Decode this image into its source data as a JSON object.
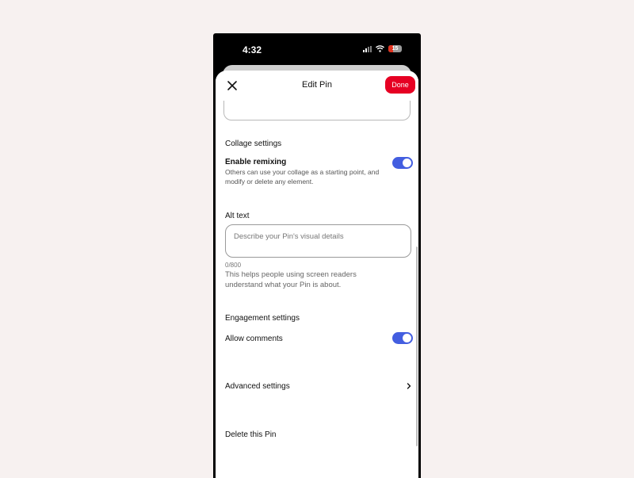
{
  "status_bar": {
    "time": "4:32",
    "battery": "15"
  },
  "header": {
    "title": "Edit Pin",
    "done_label": "Done"
  },
  "collage": {
    "section_label": "Collage settings",
    "remix_title": "Enable remixing",
    "remix_desc": "Others can use your collage as a starting point, and modify or delete any element.",
    "remix_enabled": true
  },
  "alt_text": {
    "section_label": "Alt text",
    "placeholder": "Describe your Pin's visual details",
    "counter": "0/800",
    "helper": "This helps people using screen readers understand what your Pin is about."
  },
  "engagement": {
    "section_label": "Engagement settings",
    "comments_title": "Allow comments",
    "comments_enabled": true
  },
  "advanced": {
    "label": "Advanced settings"
  },
  "delete": {
    "label": "Delete this Pin"
  },
  "colors": {
    "accent": "#e60023",
    "toggle": "#435ee0"
  },
  "icons": {
    "close": "close-icon",
    "chevron": "chevron-right-icon"
  }
}
